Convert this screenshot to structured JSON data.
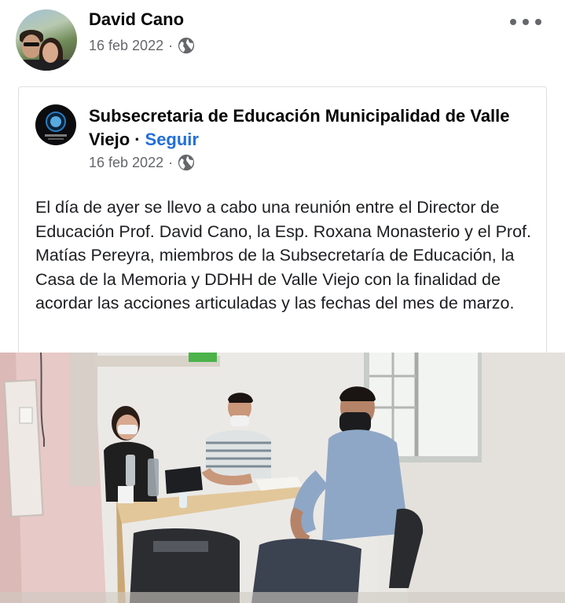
{
  "post": {
    "author": "David Cano",
    "date": "16 feb 2022",
    "privacy_icon": "globe-icon",
    "more_icon": "more-options-icon"
  },
  "shared": {
    "page_name": "Subsecretaria de Educación Municipalidad de Valle Viejo",
    "separator": "·",
    "follow_label": "Seguir",
    "date": "16 feb 2022",
    "privacy_icon": "globe-icon",
    "text": "El día de ayer se llevo a cabo una reunión entre el Director de Educación Prof. David Cano, la Esp. Roxana Monasterio y el Prof. Matías Pereyra, miembros de la Subsecretaría de Educación, la Casa de la Memoria y DDHH de Valle Viejo con la finalidad de acordar las acciones articuladas y las fechas del mes de marzo."
  },
  "colors": {
    "link": "#216fdb",
    "meta": "#65676b",
    "text": "#050505"
  }
}
